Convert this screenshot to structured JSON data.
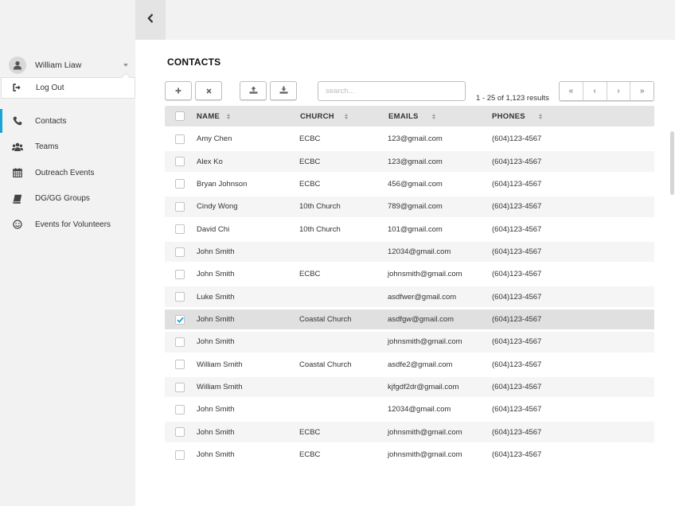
{
  "sidebar": {
    "user": {
      "name": "William Liaw",
      "menu_item": "Log Out"
    },
    "items": [
      {
        "label": "Contacts",
        "icon": "phone-icon",
        "active": true
      },
      {
        "label": "Teams",
        "icon": "users-icon",
        "active": false
      },
      {
        "label": "Outreach Events",
        "icon": "calendar-icon",
        "active": false
      },
      {
        "label": "DG/GG Groups",
        "icon": "book-icon",
        "active": false
      },
      {
        "label": "Events for Volunteers",
        "icon": "smile-icon",
        "active": false
      }
    ]
  },
  "main": {
    "title": "CONTACTS",
    "toolbar": {
      "add_icon": "plus-icon",
      "delete_icon": "times-icon",
      "upload_icon": "upload-icon",
      "download_icon": "download-icon"
    },
    "search": {
      "placeholder": "search...",
      "value": ""
    },
    "results": "1 - 25 of 1,123 results",
    "pager": [
      "«",
      "‹",
      "›",
      "»"
    ]
  },
  "table": {
    "columns": [
      "NAME",
      "CHURCH",
      "EMAILS",
      "PHONES"
    ],
    "rows": [
      {
        "name": "Amy Chen",
        "church": "ECBC",
        "email": "123@gmail.com",
        "phone": "(604)123-4567",
        "checked": false
      },
      {
        "name": "Alex Ko",
        "church": "ECBC",
        "email": "123@gmail.com",
        "phone": "(604)123-4567",
        "checked": false
      },
      {
        "name": "Bryan Johnson",
        "church": "ECBC",
        "email": "456@gmail.com",
        "phone": "(604)123-4567",
        "checked": false
      },
      {
        "name": "Cindy Wong",
        "church": "10th Church",
        "email": "789@gmail.com",
        "phone": "(604)123-4567",
        "checked": false
      },
      {
        "name": "David Chi",
        "church": "10th Church",
        "email": "101@gmail.com",
        "phone": "(604)123-4567",
        "checked": false
      },
      {
        "name": "John Smith",
        "church": "",
        "email": "12034@gmail.com",
        "phone": "(604)123-4567",
        "checked": false
      },
      {
        "name": "John Smith",
        "church": "ECBC",
        "email": "johnsmith@gmail.com",
        "phone": "(604)123-4567",
        "checked": false
      },
      {
        "name": "Luke Smith",
        "church": "",
        "email": "asdfwer@gmail.com",
        "phone": "(604)123-4567",
        "checked": false
      },
      {
        "name": "John Smith",
        "church": "Coastal Church",
        "email": "asdfgw@gmail.com",
        "phone": "(604)123-4567",
        "checked": true
      },
      {
        "name": "John Smith",
        "church": "",
        "email": "johnsmith@gmail.com",
        "phone": "(604)123-4567",
        "checked": false
      },
      {
        "name": "William Smith",
        "church": "Coastal Church",
        "email": "asdfe2@gmail.com",
        "phone": "(604)123-4567",
        "checked": false
      },
      {
        "name": "William Smith",
        "church": "",
        "email": "kjfgdf2dr@gmail.com",
        "phone": "(604)123-4567",
        "checked": false
      },
      {
        "name": "John Smith",
        "church": "",
        "email": "12034@gmail.com",
        "phone": "(604)123-4567",
        "checked": false
      },
      {
        "name": "John Smith",
        "church": "ECBC",
        "email": "johnsmith@gmail.com",
        "phone": "(604)123-4567",
        "checked": false
      },
      {
        "name": "John Smith",
        "church": "ECBC",
        "email": "johnsmith@gmail.com",
        "phone": "(604)123-4567",
        "checked": false
      }
    ]
  },
  "colors": {
    "accent": "#19a3d6",
    "sidebar_bg": "#f2f2f2",
    "header_bg": "#e4e4e4",
    "row_alt": "#f5f5f5",
    "row_selected": "#e0e0e0"
  }
}
